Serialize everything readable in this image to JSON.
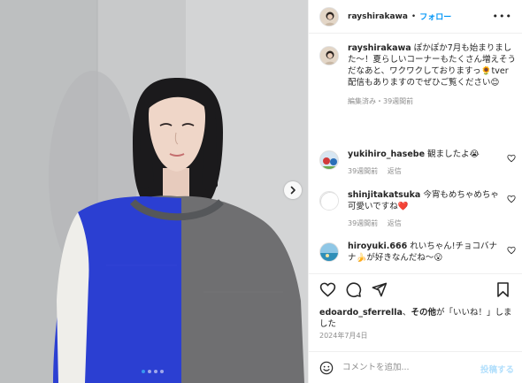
{
  "post": {
    "author": "rayshirakawa",
    "follow_label": "フォロー",
    "header_separator": "•",
    "more_label": "•••",
    "caption_text": "ぽかぽか7月も始まりました〜！夏らしいコーナーもたくさん増えそうだなあと、ワクワクしておりますっ🌻tver配信もありますのでぜひご覧ください😊",
    "caption_edited": "編集済み",
    "caption_age": "39週間前",
    "caption_meta_separator": "・",
    "carousel": {
      "count": 4,
      "active_index": 0
    }
  },
  "comments": [
    {
      "username": "yukihiro_hasebe",
      "text": "観ましたよ😭",
      "age": "39週間前",
      "reply_label": "返信"
    },
    {
      "username": "shinjitakatsuka",
      "text": "今宵もめちゃめちゃ可愛いですね❤️",
      "age": "39週間前",
      "reply_label": "返信"
    },
    {
      "username": "hiroyuki.666",
      "text": "れいちゃん!チョコバナナ🍌が好きなんだね〜😮",
      "age": "",
      "reply_label": ""
    }
  ],
  "likes": {
    "user": "edoardo_sferrella",
    "between": "、",
    "others": "その他",
    "suffix": "が「いいね！」しました"
  },
  "date": "2024年7月4日",
  "composer": {
    "placeholder": "コメントを追加...",
    "post_label": "投稿する"
  },
  "icons": {
    "action_bar": [
      "heart-icon",
      "comment-icon",
      "share-icon",
      "bookmark-icon"
    ],
    "composer": "emoji-icon",
    "carousel_next": "chevron-right-icon"
  },
  "colors": {
    "follow": "#0095f6",
    "post_button": "#b2dffc",
    "sweater_blue": "#2a3fd4",
    "sweater_gray": "#6f6f70",
    "wall": "#c9cbcc"
  }
}
